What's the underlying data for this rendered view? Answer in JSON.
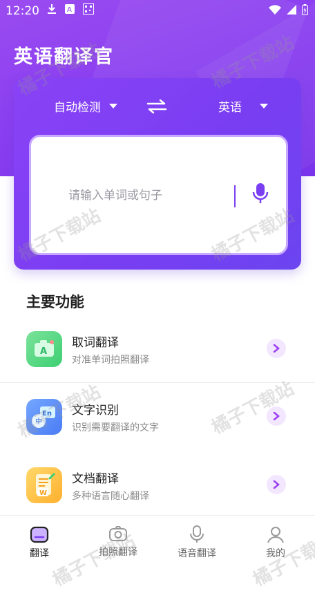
{
  "status_bar": {
    "time": "12:20"
  },
  "app_title": "英语翻译官",
  "translator": {
    "source_lang": "自动检测",
    "target_lang": "英语",
    "input_placeholder": "请输入单词或句子"
  },
  "section_title": "主要功能",
  "features": [
    {
      "name": "取词翻译",
      "desc": "对准单词拍照翻译",
      "icon": "camera-a-icon"
    },
    {
      "name": "文字识别",
      "desc": "识别需要翻译的文字",
      "icon": "text-recognition-icon"
    },
    {
      "name": "文档翻译",
      "desc": "多种语言随心翻译",
      "icon": "document-word-icon"
    }
  ],
  "bottom_nav": [
    {
      "label": "翻译",
      "active": true,
      "icon": "translate-icon"
    },
    {
      "label": "拍照翻译",
      "active": false,
      "icon": "camera-icon"
    },
    {
      "label": "语音翻译",
      "active": false,
      "icon": "microphone-icon"
    },
    {
      "label": "我的",
      "active": false,
      "icon": "profile-icon"
    }
  ],
  "watermark": "橘子下载站",
  "colors": {
    "primary": "#7b3ff2",
    "accent_light": "#f3e6ff"
  }
}
